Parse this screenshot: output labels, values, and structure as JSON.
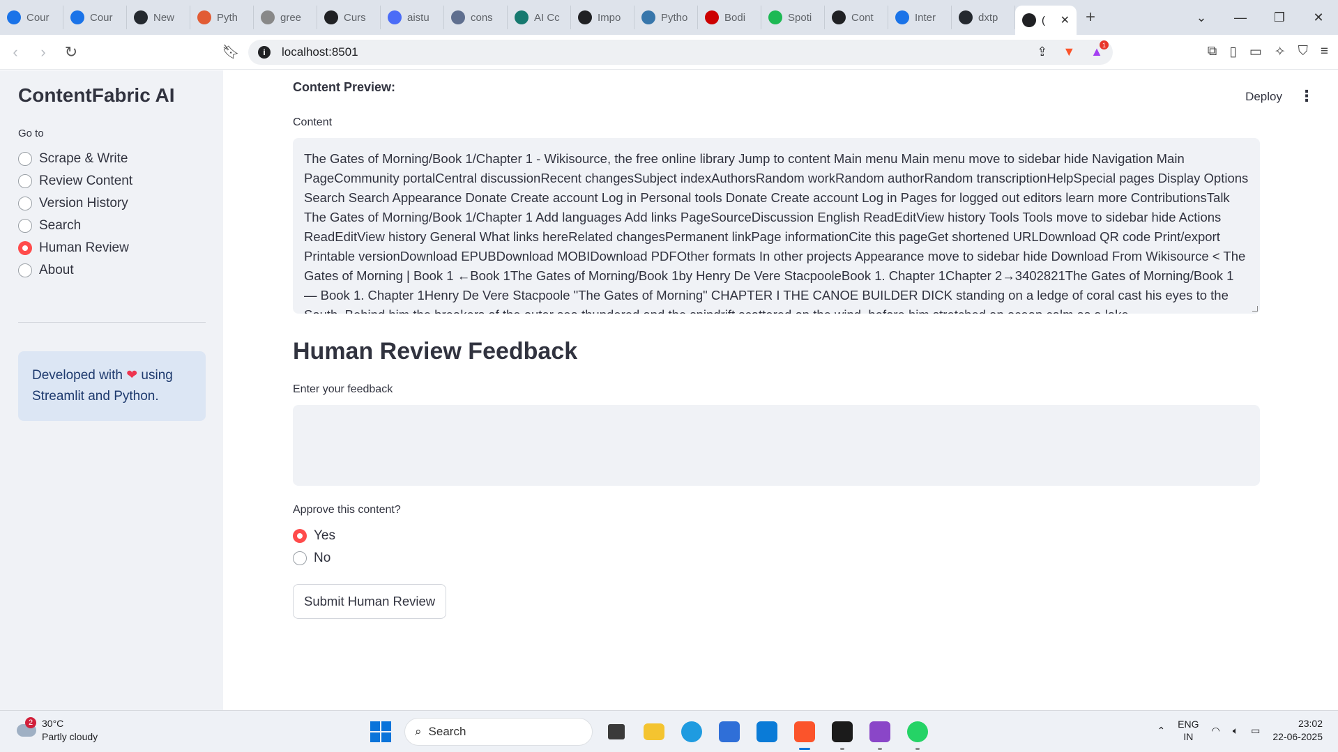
{
  "browser": {
    "tabs": [
      {
        "label": "Cour",
        "icon": "c-icon",
        "color": "#1a73e8"
      },
      {
        "label": "Cour",
        "icon": "c-icon",
        "color": "#1a73e8"
      },
      {
        "label": "New",
        "icon": "github-icon",
        "color": "#24292f"
      },
      {
        "label": "Pyth",
        "icon": "spark-icon",
        "color": "#e25c34"
      },
      {
        "label": "gree",
        "icon": "spinner-icon",
        "color": "#888888"
      },
      {
        "label": "Curs",
        "icon": "openai-icon",
        "color": "#202124"
      },
      {
        "label": "aistu",
        "icon": "gear-icon",
        "color": "#4a6cf7"
      },
      {
        "label": "cons",
        "icon": "api-icon",
        "color": "#5f6f8f"
      },
      {
        "label": "AI Cc",
        "icon": "ai-icon",
        "color": "#16796f"
      },
      {
        "label": "Impo",
        "icon": "openai-icon",
        "color": "#202124"
      },
      {
        "label": "Pytho",
        "icon": "python-icon",
        "color": "#3776ab"
      },
      {
        "label": "Bodi",
        "icon": "cnn-icon",
        "color": "#cc0000"
      },
      {
        "label": "Spoti",
        "icon": "spotify-icon",
        "color": "#1db954"
      },
      {
        "label": "Cont",
        "icon": "streamlit-icon",
        "color": "#202124"
      },
      {
        "label": "Inter",
        "icon": "is-icon",
        "color": "#1a73e8"
      },
      {
        "label": "dxtp",
        "icon": "github-icon",
        "color": "#24292f"
      }
    ],
    "active_tab": {
      "label": "(",
      "icon": "streamlit-icon"
    },
    "new_tab_glyph": "+",
    "url": "localhost:8501",
    "brave_badge_count": "1"
  },
  "sidebar": {
    "title": "ContentFabric AI",
    "goto_label": "Go to",
    "nav": [
      {
        "label": "Scrape & Write",
        "checked": false
      },
      {
        "label": "Review Content",
        "checked": false
      },
      {
        "label": "Version History",
        "checked": false
      },
      {
        "label": "Search",
        "checked": false
      },
      {
        "label": "Human Review",
        "checked": true
      },
      {
        "label": "About",
        "checked": false
      }
    ],
    "info_prefix": "Developed with",
    "info_suffix": "using Streamlit and Python."
  },
  "main": {
    "deploy_label": "Deploy",
    "preview_label": "Content Preview:",
    "content_label": "Content",
    "content_text": "The Gates of Morning/Book 1/Chapter 1 - Wikisource, the free online library Jump to content Main menu Main menu move to sidebar hide Navigation Main PageCommunity portalCentral discussionRecent changesSubject indexAuthorsRandom workRandom authorRandom transcriptionHelpSpecial pages Display Options Search Search Appearance Donate Create account Log in Personal tools Donate Create account Log in Pages for logged out editors learn more ContributionsTalk The Gates of Morning/Book 1/Chapter 1 Add languages Add links PageSourceDiscussion English ReadEditView history Tools Tools move to sidebar hide Actions ReadEditView history General What links hereRelated changesPermanent linkPage informationCite this pageGet shortened URLDownload QR code Print/export Printable versionDownload EPUBDownload MOBIDownload PDFOther formats In other projects Appearance move to sidebar hide Download From Wikisource < The Gates of Morning | Book 1 ←Book 1The Gates of Morning/Book 1by Henry De Vere StacpooleBook 1. Chapter 1Chapter 2→3402821The Gates of Morning/Book 1 — Book 1. Chapter 1Henry De Vere Stacpoole  \"The Gates of Morning\" CHAPTER I THE CANOE BUILDER DICK standing on a ledge of coral cast his eyes to the South. Behind him the breakers of the outer sea thundered and the spindrift scattered on the wind, before him stretched an ocean calm as a lake",
    "feedback_title": "Human Review Feedback",
    "feedback_label": "Enter your feedback",
    "feedback_value": "",
    "approve_label": "Approve this content?",
    "approve_options": [
      {
        "label": "Yes",
        "checked": true
      },
      {
        "label": "No",
        "checked": false
      }
    ],
    "submit_label": "Submit Human Review"
  },
  "taskbar": {
    "weather_temp": "30°C",
    "weather_desc": "Partly cloudy",
    "weather_badge": "2",
    "search_placeholder": "Search",
    "lang_top": "ENG",
    "lang_bottom": "IN",
    "time": "23:02",
    "date": "22-06-2025"
  },
  "colors": {
    "accent": "#ff4b4b",
    "sidebar_bg": "#f0f2f6",
    "info_bg": "#dce6f4"
  }
}
